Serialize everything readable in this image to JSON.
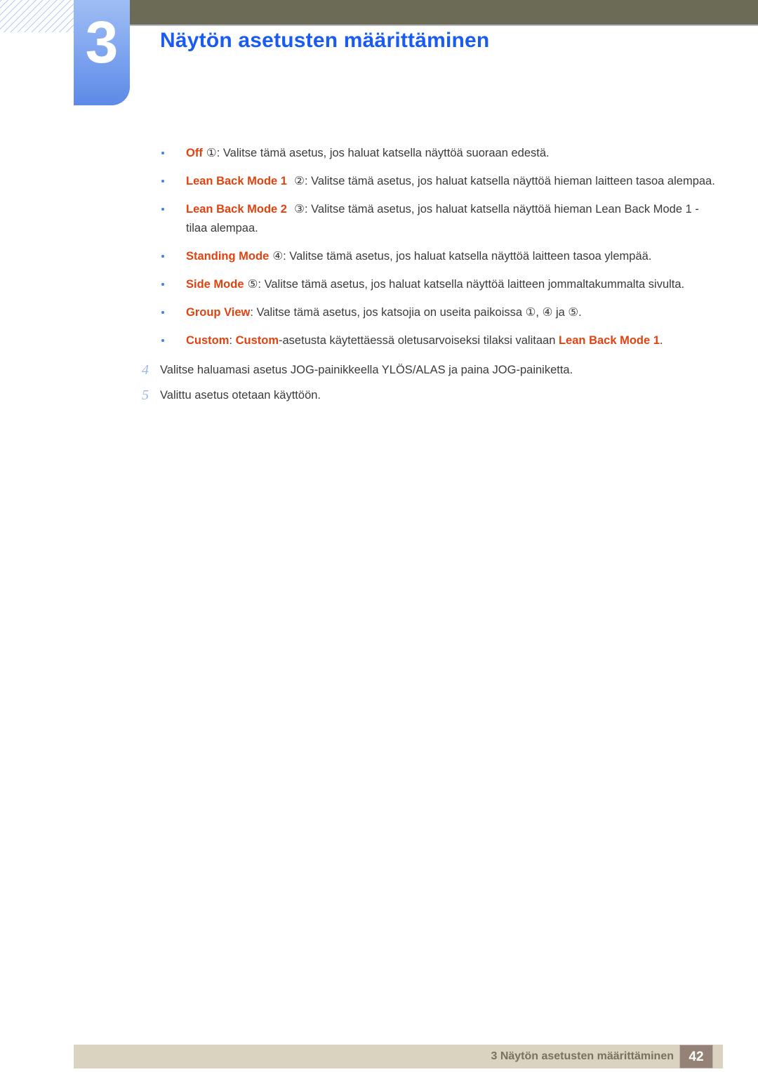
{
  "header": {
    "chapter_number": "3",
    "title": "Näytön asetusten määrittäminen"
  },
  "content": {
    "bullets": [
      {
        "term": "Off",
        "circle": "①",
        "text": ": Valitse tämä asetus, jos haluat katsella näyttöä suoraan edestä."
      },
      {
        "term": "Lean Back Mode 1",
        "circle": "②",
        "text": ": Valitse tämä asetus, jos haluat katsella näyttöä hieman laitteen tasoa alempaa."
      },
      {
        "term": "Lean Back Mode 2",
        "circle": "③",
        "text": ": Valitse tämä asetus, jos haluat katsella näyttöä hieman Lean Back Mode 1 -tilaa alempaa."
      },
      {
        "term": "Standing Mode",
        "circle": "④",
        "text": ": Valitse tämä asetus, jos haluat katsella näyttöä laitteen tasoa ylempää."
      },
      {
        "term": "Side Mode",
        "circle": "⑤",
        "text": ": Valitse tämä asetus, jos haluat katsella näyttöä laitteen jommaltakummalta sivulta."
      },
      {
        "term": "Group View",
        "circle": "",
        "text": ": Valitse tämä asetus, jos katsojia on useita paikoissa ①, ④ ja ⑤."
      },
      {
        "term": "Custom",
        "circle": "",
        "text": ": Custom-asetusta käytettäessä oletusarvoiseksi tilaksi valitaan Lean Back Mode 1.",
        "text_pre": ": ",
        "term2": "Custom",
        "text_mid": "-asetusta käytettäessä oletusarvoiseksi tilaksi valitaan ",
        "term3": "Lean Back Mode 1",
        "text_post": "."
      }
    ],
    "steps": [
      {
        "number": "4",
        "text": "Valitse haluamasi asetus JOG-painikkeella YLÖS/ALAS ja paina JOG-painiketta."
      },
      {
        "number": "5",
        "text": "Valittu asetus otetaan käyttöön."
      }
    ]
  },
  "footer": {
    "text": "3 Näytön asetusten määrittäminen",
    "page_number": "42"
  },
  "colors": {
    "header_bar": "#6c6b56",
    "title_blue": "#1a5cf0",
    "term_orange": "#e14310",
    "step_number_blue": "#9fb8e8",
    "footer_bar": "#d9d3c0",
    "footer_page_box": "#938275"
  }
}
